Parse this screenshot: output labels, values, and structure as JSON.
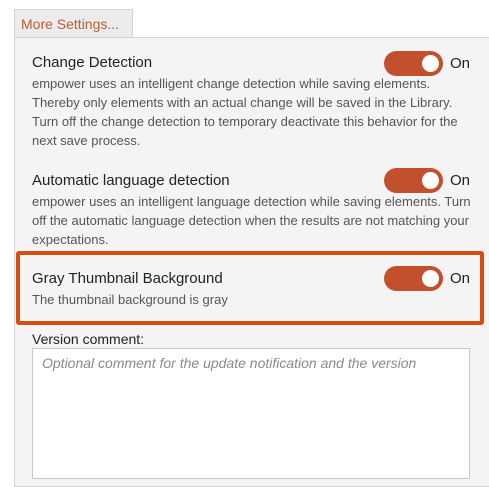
{
  "tab": {
    "label": "More Settings..."
  },
  "settings": [
    {
      "title": "Change Detection",
      "toggle_state": "On",
      "enabled": true,
      "description": "empower uses an intelligent change detection while saving elements. Thereby only elements with an actual change will be saved in the Library. Turn off the change detection to temporary deactivate this behavior for the next save process."
    },
    {
      "title": "Automatic language detection",
      "toggle_state": "On",
      "enabled": true,
      "description": "empower uses an intelligent language detection while saving elements. Turn off the automatic language detection when the results are not matching your expectations."
    },
    {
      "title": "Gray Thumbnail Background",
      "toggle_state": "On",
      "enabled": true,
      "description": "The thumbnail background is gray"
    }
  ],
  "version_comment": {
    "label": "Version comment:",
    "placeholder": "Optional comment for the update notification and the version",
    "value": ""
  },
  "colors": {
    "accent": "#c2502c",
    "tab_text": "#c35a33",
    "highlight_border": "#d94d12",
    "panel_bg": "#f4f4f4"
  }
}
